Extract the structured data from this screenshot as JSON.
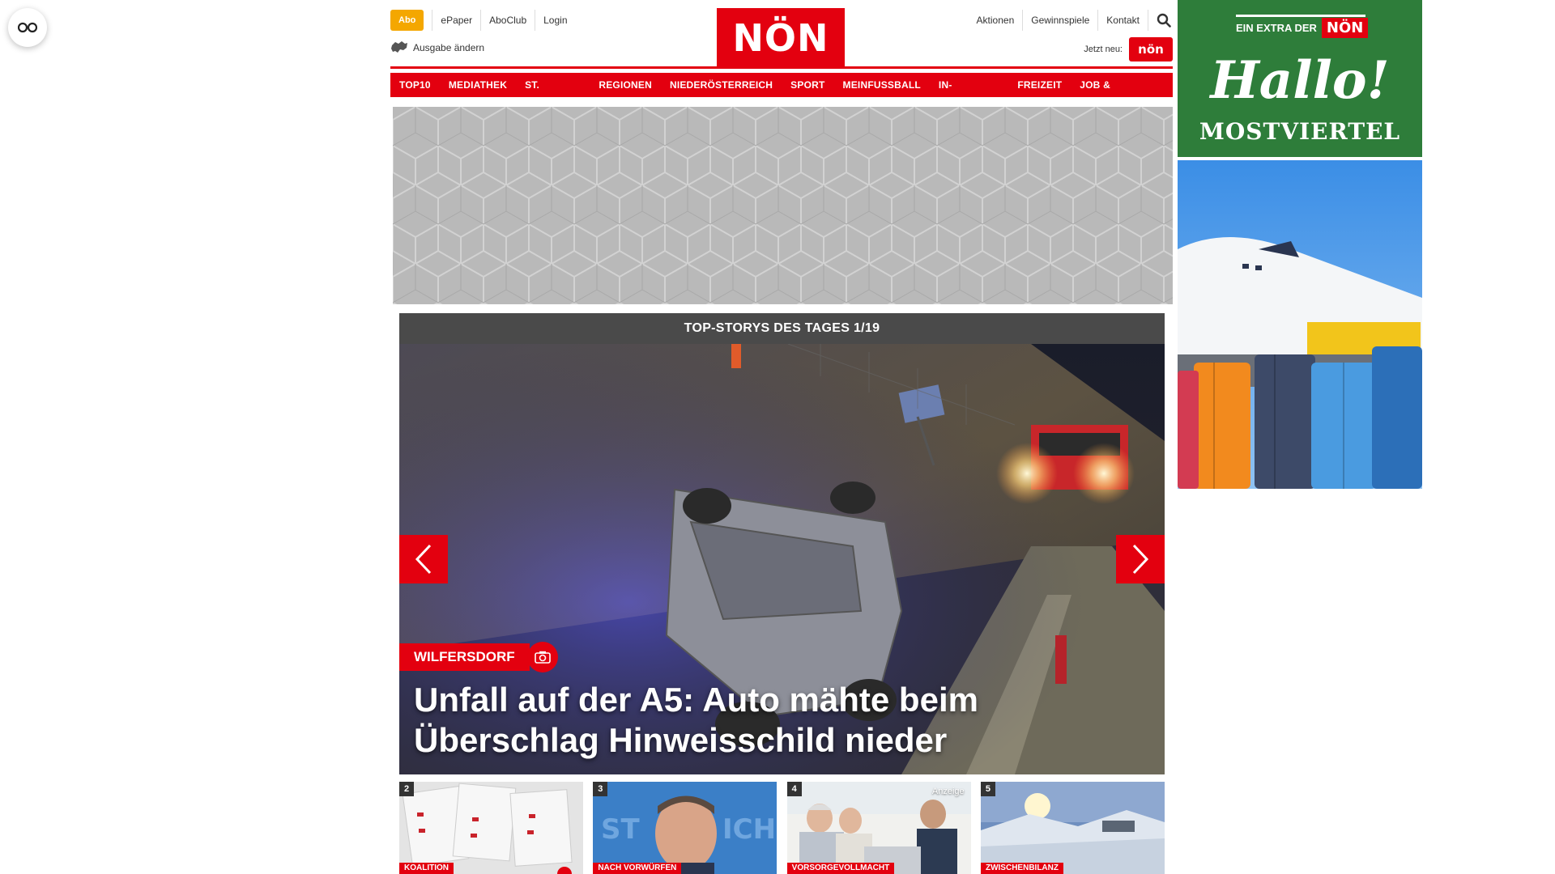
{
  "header": {
    "abo_label": "Abo",
    "left_links": [
      "ePaper",
      "AboClub",
      "Login"
    ],
    "ausgabe_label": "Ausgabe ändern",
    "logo_text": "NÖN",
    "right_links": [
      "Aktionen",
      "Gewinnspiele",
      "Kontakt"
    ],
    "jetzt_label": "Jetzt neu:",
    "jetzt_badge": "nön"
  },
  "nav": {
    "items": [
      "TOP10",
      "MEDIATHEK",
      "ST. PÖLTEN",
      "REGIONEN",
      "NIEDERÖSTERREICH",
      "SPORT",
      "MEINFUSSBALL",
      "IN-AUSLAND",
      "FREIZEIT",
      "JOB & KARRIERE"
    ]
  },
  "slider": {
    "heading": "TOP-STORYS DES TAGES 1/19",
    "category": "WILFERSDORF",
    "headline": "Unfall auf der A5: Auto mähte beim Überschlag Hinweisschild nieder"
  },
  "thumbs": [
    {
      "num": "2",
      "tag": "KOALITION",
      "badge": ""
    },
    {
      "num": "3",
      "tag": "NACH VORWÜRFEN",
      "badge": ""
    },
    {
      "num": "4",
      "tag": "VORSORGEVOLLMACHT",
      "badge": "Anzeige"
    },
    {
      "num": "5",
      "tag": "ZWISCHENBILANZ",
      "badge": ""
    }
  ],
  "side_ad": {
    "extra_label": "EIN EXTRA DER",
    "extra_logo": "NÖN",
    "title": "Hallo!",
    "subtitle": "MOSTVIERTEL"
  },
  "colors": {
    "brand_red": "#e3000f",
    "abo_orange": "#f4a700",
    "ad_green": "#2e7d3a"
  }
}
